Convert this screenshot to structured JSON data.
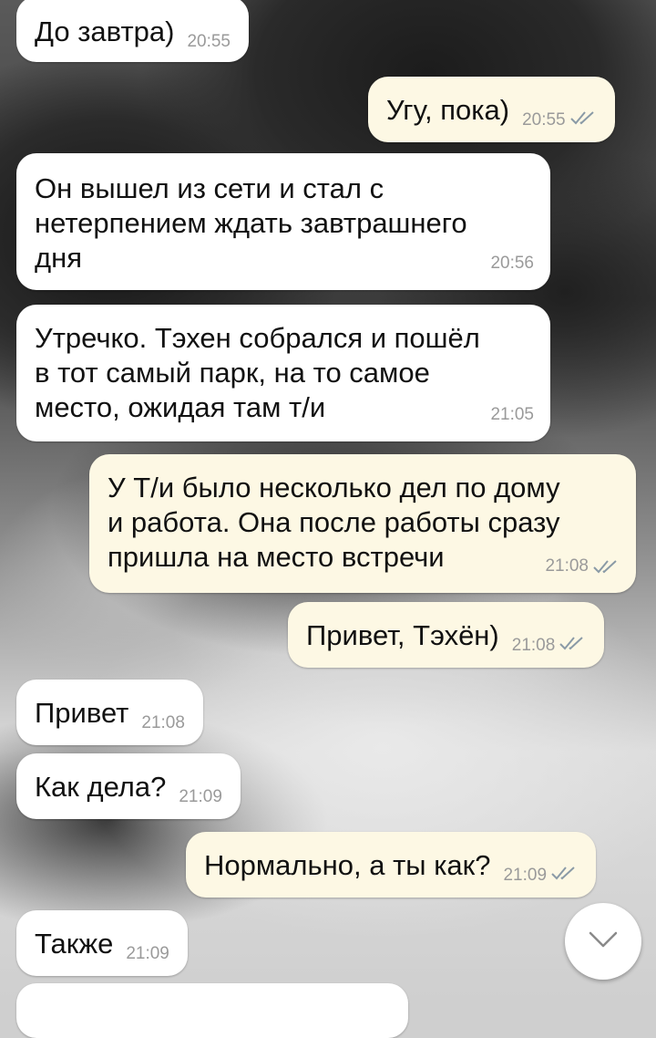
{
  "messages": [
    {
      "text": "До завтра)",
      "time": "20:55",
      "direction": "in"
    },
    {
      "text": "Угу, пока)",
      "time": "20:55",
      "direction": "out",
      "read": true
    },
    {
      "text": "Он вышел из сети и стал с\nнетерпением ждать завтрашнего\nдня",
      "time": "20:56",
      "direction": "in"
    },
    {
      "text": "Утречко. Тэхен собрался и пошёл\nв тот самый парк, на то самое\nместо, ожидая там т/и",
      "time": "21:05",
      "direction": "in"
    },
    {
      "text": "У Т/и было несколько дел по дому\nи работа. Она после работы сразу\nпришла на место встречи",
      "time": "21:08",
      "direction": "out",
      "read": true
    },
    {
      "text": "Привет, Тэхён)",
      "time": "21:08",
      "direction": "out",
      "read": true
    },
    {
      "text": "Привет",
      "time": "21:08",
      "direction": "in"
    },
    {
      "text": "Как дела?",
      "time": "21:09",
      "direction": "in"
    },
    {
      "text": "Нормально, а ты как?",
      "time": "21:09",
      "direction": "out",
      "read": true
    },
    {
      "text": "Также",
      "time": "21:09",
      "direction": "in"
    }
  ],
  "icons": {
    "read_ticks": "double-check-icon",
    "scroll_down": "chevron-down-icon"
  },
  "colors": {
    "incoming_bubble": "#ffffff",
    "outgoing_bubble": "#fdf8e4",
    "time_text": "#9a9a9a",
    "ticks": "#8a9aa6"
  }
}
